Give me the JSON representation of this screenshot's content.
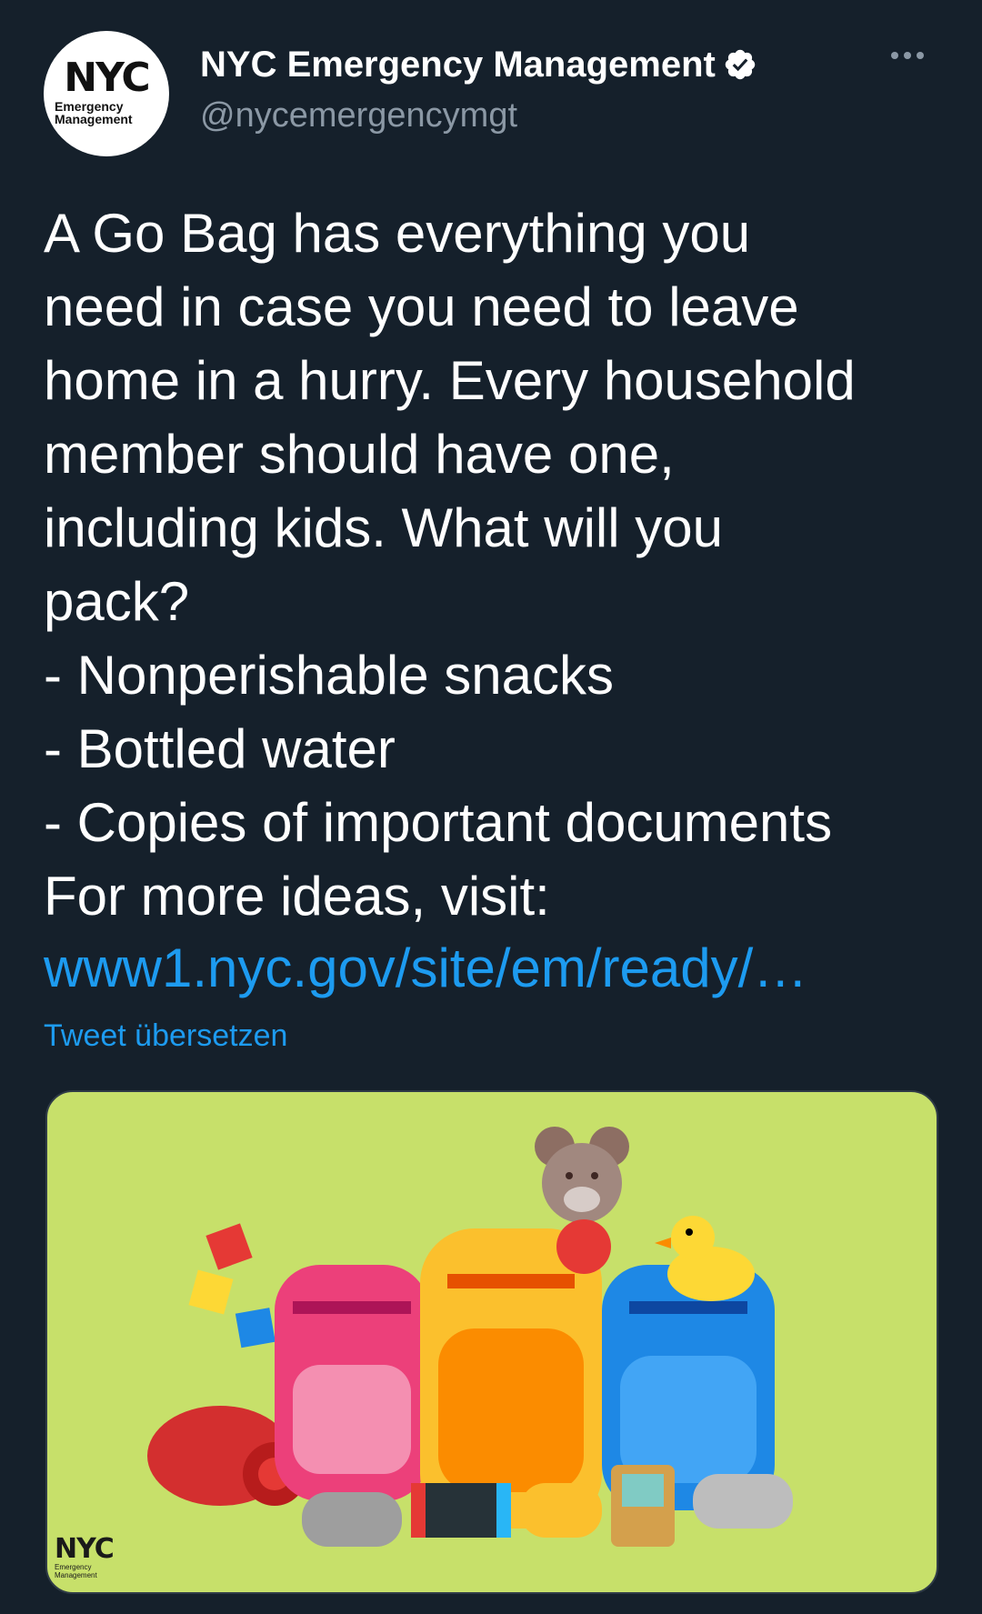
{
  "account": {
    "display_name": "NYC Emergency Management",
    "handle": "@nycemergencymgt",
    "avatar_logo": "NYC",
    "avatar_subtitle_line1": "Emergency",
    "avatar_subtitle_line2": "Management",
    "verified": true
  },
  "tweet": {
    "text": "A Go Bag has everything you\nneed in case you need to leave\nhome in a hurry. Every household\nmember should have one,\nincluding kids. What will you\npack?\n- Nonperishable snacks\n- Bottled water\n- Copies of important documents\nFor more ideas, visit:",
    "link_text": "www1.nyc.gov/site/em/ready/…",
    "translate_label": "Tweet übersetzen"
  },
  "media": {
    "background_color": "#c7e06a",
    "logo_text": "NYC",
    "logo_subtitle_line1": "Emergency",
    "logo_subtitle_line2": "Management"
  },
  "icons": {
    "more": "more-horizontal-icon",
    "verified": "verified-badge-icon"
  },
  "colors": {
    "background": "#15202b",
    "text_primary": "#ffffff",
    "text_secondary": "#8b98a5",
    "accent": "#1d9bf0"
  }
}
